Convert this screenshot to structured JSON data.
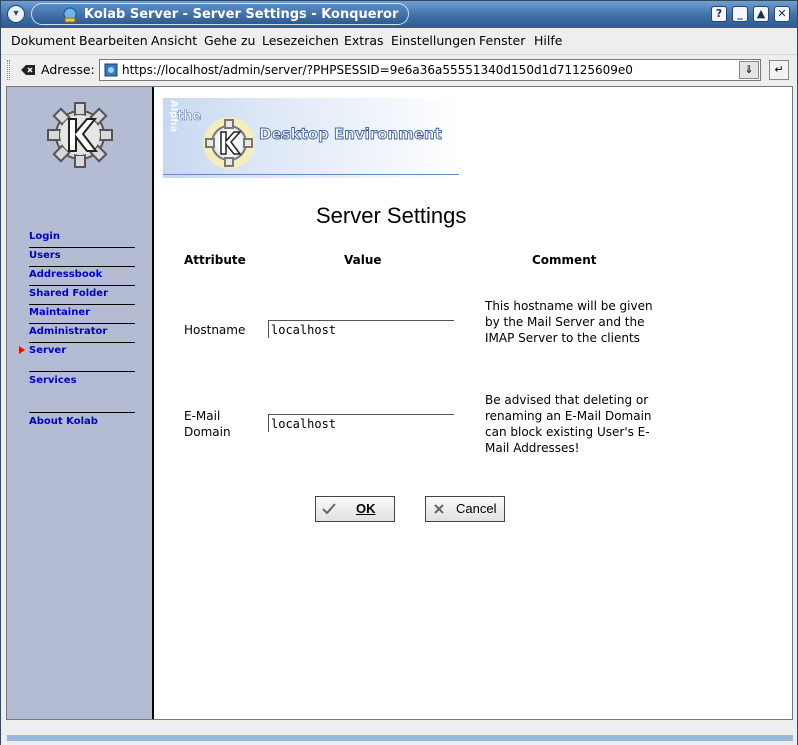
{
  "window": {
    "title": "Kolab Server - Server Settings - Konqueror",
    "buttons": {
      "help": "?",
      "minimize": "_",
      "maximize": "▲",
      "close": "✕"
    }
  },
  "menu": [
    "Dokument",
    "Bearbeiten",
    "Ansicht",
    "Gehe zu",
    "Lesezeichen",
    "Extras",
    "Einstellungen",
    "Fenster",
    "Hilfe"
  ],
  "address": {
    "label": "Adresse:",
    "url": "https://localhost/admin/server/?PHPSESSID=9e6a36a55551340d150d1d71125609e0"
  },
  "sidebar": {
    "items": [
      {
        "label": "Login"
      },
      {
        "label": "Users"
      },
      {
        "label": "Addressbook"
      },
      {
        "label": "Shared Folder"
      },
      {
        "label": "Maintainer"
      },
      {
        "label": "Administrator"
      },
      {
        "label": "Server",
        "active": true
      },
      {
        "label": "Services"
      },
      {
        "label": "About Kolab"
      }
    ]
  },
  "banner": {
    "text_the": "the",
    "text_de": "Desktop Environment",
    "text_alpha": "Alpha"
  },
  "page": {
    "title": "Server Settings",
    "columns": {
      "attribute": "Attribute",
      "value": "Value",
      "comment": "Comment"
    },
    "rows": [
      {
        "label": "Hostname",
        "value": "localhost",
        "comment": "This hostname will be given by the Mail Server and the IMAP Server to the clients"
      },
      {
        "label": "E-Mail Domain",
        "value": "localhost",
        "comment": "Be advised that deleting or renaming an E-Mail Domain can block existing User's E-Mail Addresses!"
      }
    ],
    "ok_label": "OK",
    "cancel_label": "Cancel"
  },
  "colors": {
    "sidebar": "#b4bcd4",
    "link": "#0000cc",
    "titlebar": "#3f6fa6"
  }
}
